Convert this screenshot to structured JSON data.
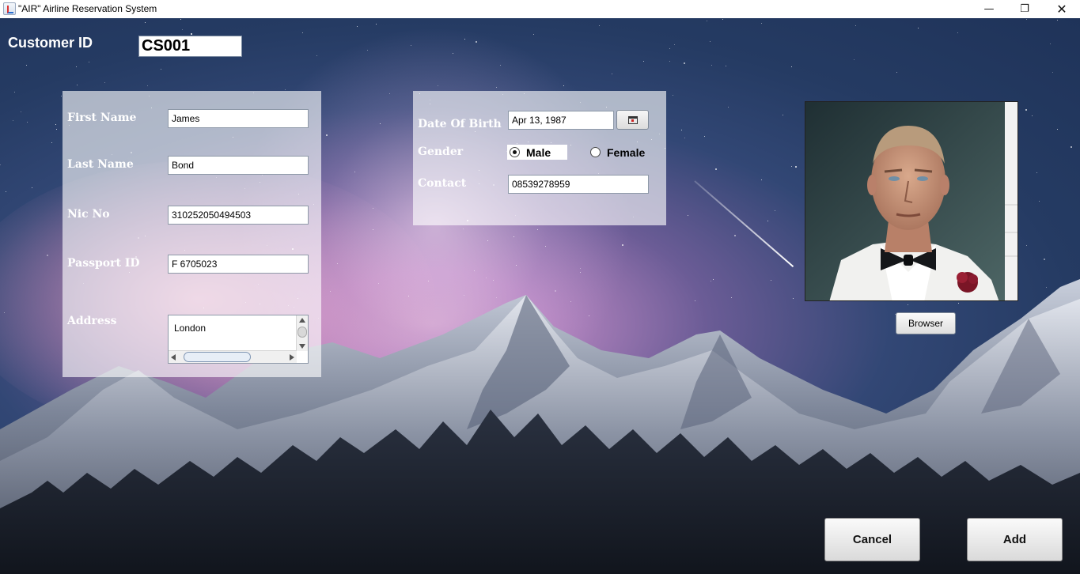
{
  "window": {
    "title": "\"AIR\" Airline Reservation System",
    "controls": {
      "minimize": "—",
      "maximize": "❐",
      "close": "✕"
    }
  },
  "customer": {
    "id_label": "Customer ID",
    "id_value": "CS001"
  },
  "personal": {
    "first_name_label": "First Name",
    "first_name_value": "James",
    "last_name_label": "Last Name",
    "last_name_value": "Bond",
    "nic_label": "Nic No",
    "nic_value": "310252050494503",
    "passport_label": "Passport ID",
    "passport_value": "F 6705023",
    "address_label": "Address",
    "address_value": "London"
  },
  "details": {
    "dob_label": "Date Of Birth",
    "dob_value": "Apr 13, 1987",
    "gender_label": "Gender",
    "gender_options": [
      "Male",
      "Female"
    ],
    "gender_selected": "Male",
    "contact_label": "Contact",
    "contact_value": "08539278959"
  },
  "photo": {
    "browse_label": "Browser"
  },
  "actions": {
    "cancel_label": "Cancel",
    "add_label": "Add"
  },
  "colors": {
    "sky_top": "#1f3359",
    "sky_pink": "#d6a7cf",
    "panel_overlay": "rgba(255,255,255,0.62)",
    "mountain": "#5b6577",
    "forest": "#1e2430"
  },
  "icons": [
    "app-icon",
    "calendar-icon",
    "minimize-icon",
    "maximize-icon",
    "close-icon"
  ]
}
